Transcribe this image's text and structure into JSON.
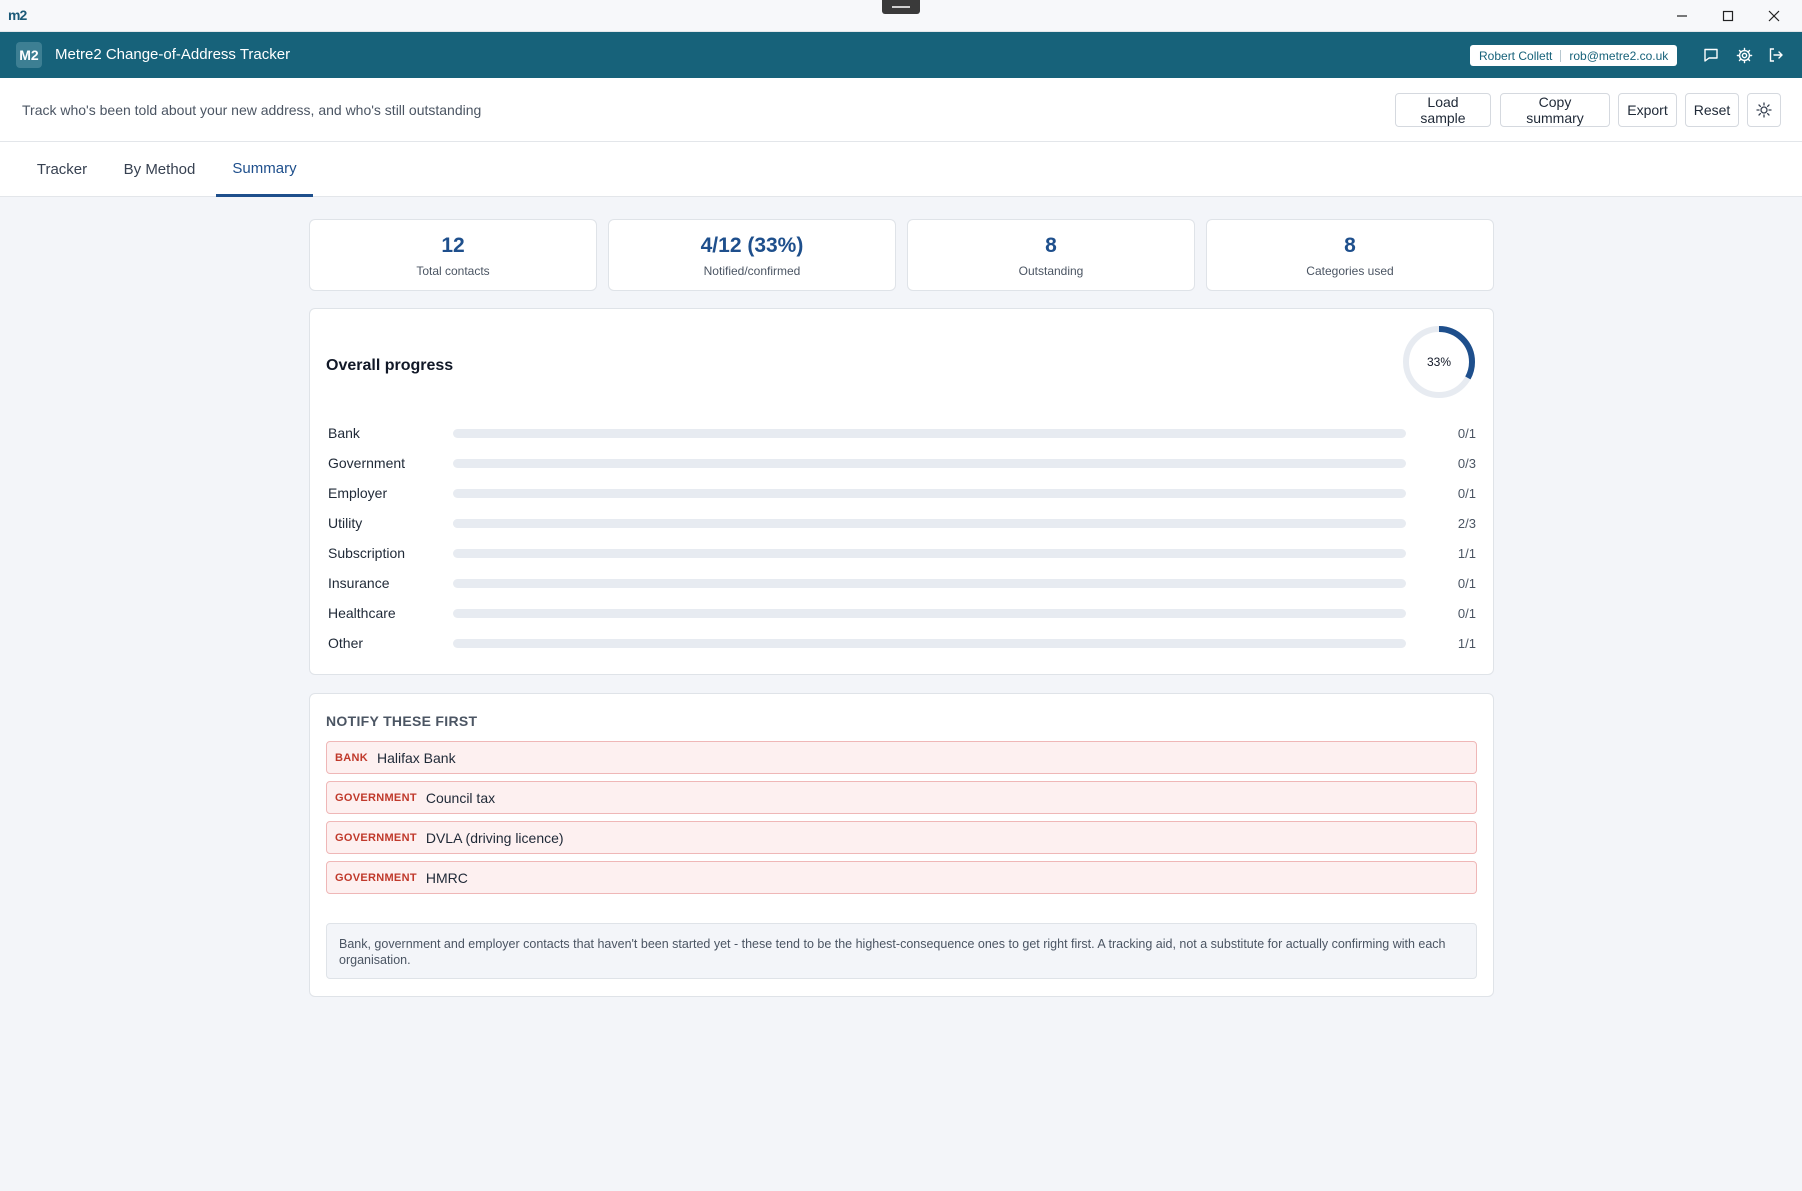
{
  "os": {
    "logo": "m2"
  },
  "header": {
    "logo": "M2",
    "title": "Metre2 Change-of-Address Tracker",
    "user_name": "Robert Collett",
    "user_email": "rob@metre2.co.uk"
  },
  "toolbar": {
    "subtitle": "Track who's been told about your new address, and who's still outstanding",
    "load_sample": "Load sample",
    "copy_summary": "Copy summary",
    "export": "Export",
    "reset": "Reset"
  },
  "tabs": [
    {
      "label": "Tracker",
      "active": false
    },
    {
      "label": "By Method",
      "active": false
    },
    {
      "label": "Summary",
      "active": true
    }
  ],
  "stats": [
    {
      "value": "12",
      "label": "Total contacts"
    },
    {
      "value": "4/12 (33%)",
      "label": "Notified/confirmed"
    },
    {
      "value": "8",
      "label": "Outstanding"
    },
    {
      "value": "8",
      "label": "Categories used"
    }
  ],
  "progress": {
    "title": "Overall progress",
    "percent": 33,
    "percent_label": "33%",
    "ring_color": "#1e4f8c",
    "categories": [
      {
        "label": "Bank",
        "done": 0,
        "total": 1,
        "count": "0/1"
      },
      {
        "label": "Government",
        "done": 0,
        "total": 3,
        "count": "0/3"
      },
      {
        "label": "Employer",
        "done": 0,
        "total": 1,
        "count": "0/1"
      },
      {
        "label": "Utility",
        "done": 2,
        "total": 3,
        "count": "2/3"
      },
      {
        "label": "Subscription",
        "done": 1,
        "total": 1,
        "count": "1/1"
      },
      {
        "label": "Insurance",
        "done": 0,
        "total": 1,
        "count": "0/1"
      },
      {
        "label": "Healthcare",
        "done": 0,
        "total": 1,
        "count": "0/1"
      },
      {
        "label": "Other",
        "done": 1,
        "total": 1,
        "count": "1/1"
      }
    ]
  },
  "notify": {
    "title": "NOTIFY THESE FIRST",
    "items": [
      {
        "tag": "BANK",
        "name": "Halifax Bank"
      },
      {
        "tag": "GOVERNMENT",
        "name": "Council tax"
      },
      {
        "tag": "GOVERNMENT",
        "name": "DVLA (driving licence)"
      },
      {
        "tag": "GOVERNMENT",
        "name": "HMRC"
      }
    ],
    "note": "Bank, government and employer contacts that haven't been started yet - these tend to be the highest-consequence ones to get right first. A tracking aid, not a substitute for actually confirming with each organisation."
  }
}
